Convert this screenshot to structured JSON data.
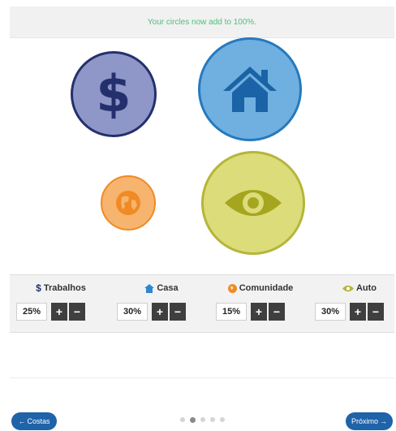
{
  "status_message": "Your circles now add to 100%.",
  "colors": {
    "money": "#8e97c7",
    "house": "#6fb0e0",
    "community": "#f6b46e",
    "auto": "#dcdc7a",
    "status_text": "#4cbf7a",
    "nav_button": "#1f63a8"
  },
  "circles": [
    {
      "name": "money-circle",
      "icon": "dollar-icon"
    },
    {
      "name": "house-circle",
      "icon": "house-icon"
    },
    {
      "name": "community-circle",
      "icon": "globe-icon"
    },
    {
      "name": "auto-circle",
      "icon": "eye-icon"
    }
  ],
  "categories": [
    {
      "label": "Trabalhos",
      "value": "25%",
      "icon": "dollar-icon"
    },
    {
      "label": "Casa",
      "value": "30%",
      "icon": "house-icon"
    },
    {
      "label": "Comunidade",
      "value": "15%",
      "icon": "globe-icon"
    },
    {
      "label": "Auto",
      "value": "30%",
      "icon": "eye-icon"
    }
  ],
  "buttons": {
    "plus": "+",
    "minus": "−"
  },
  "nav": {
    "back": "Costas",
    "next": "Próximo"
  },
  "pagination": {
    "total": 5,
    "current": 2
  }
}
